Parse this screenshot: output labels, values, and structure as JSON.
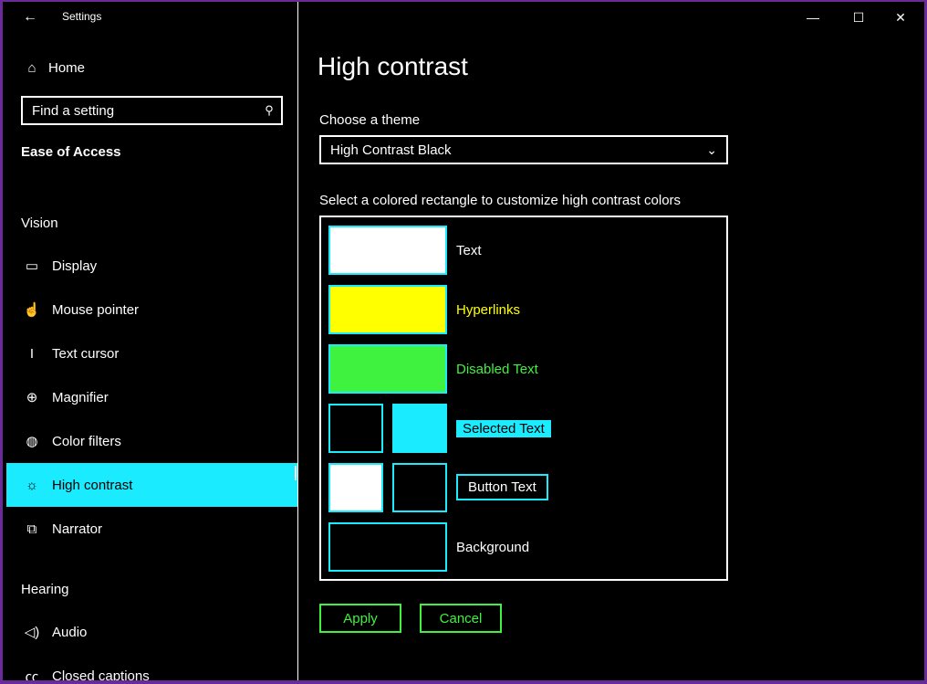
{
  "window": {
    "title": "Settings",
    "controls": {
      "minimize": "—",
      "maximize": "☐",
      "close": "✕"
    }
  },
  "sidebar": {
    "home_label": "Home",
    "search_placeholder": "Find a setting",
    "section_title": "Ease of Access",
    "groups": [
      {
        "label": "Vision"
      },
      {
        "label": "Hearing"
      }
    ],
    "items": [
      {
        "label": "Display",
        "icon": "monitor-icon"
      },
      {
        "label": "Mouse pointer",
        "icon": "pointer-icon"
      },
      {
        "label": "Text cursor",
        "icon": "text-cursor-icon"
      },
      {
        "label": "Magnifier",
        "icon": "magnifier-icon"
      },
      {
        "label": "Color filters",
        "icon": "palette-icon"
      },
      {
        "label": "High contrast",
        "icon": "sun-icon",
        "selected": true
      },
      {
        "label": "Narrator",
        "icon": "narrator-icon"
      },
      {
        "label": "Audio",
        "icon": "speaker-icon"
      },
      {
        "label": "Closed captions",
        "icon": "captions-icon"
      }
    ]
  },
  "main": {
    "title": "High contrast",
    "theme_label": "Choose a theme",
    "theme_value": "High Contrast Black",
    "instructions": "Select a colored rectangle to customize high contrast colors",
    "swatch_labels": {
      "text": "Text",
      "hyperlinks": "Hyperlinks",
      "disabled_text": "Disabled Text",
      "selected_text": "Selected Text",
      "button_text": "Button Text",
      "background": "Background"
    },
    "colors": {
      "text": "#ffffff",
      "hyperlinks": "#ffff00",
      "disabled_text": "#3ff23f",
      "selected_bg": "#000000",
      "selected_fg": "#1aebff",
      "button_bg": "#ffffff",
      "button_fg": "#000000",
      "background": "#000000",
      "accent": "#1aebff"
    },
    "apply_label": "Apply",
    "cancel_label": "Cancel"
  }
}
